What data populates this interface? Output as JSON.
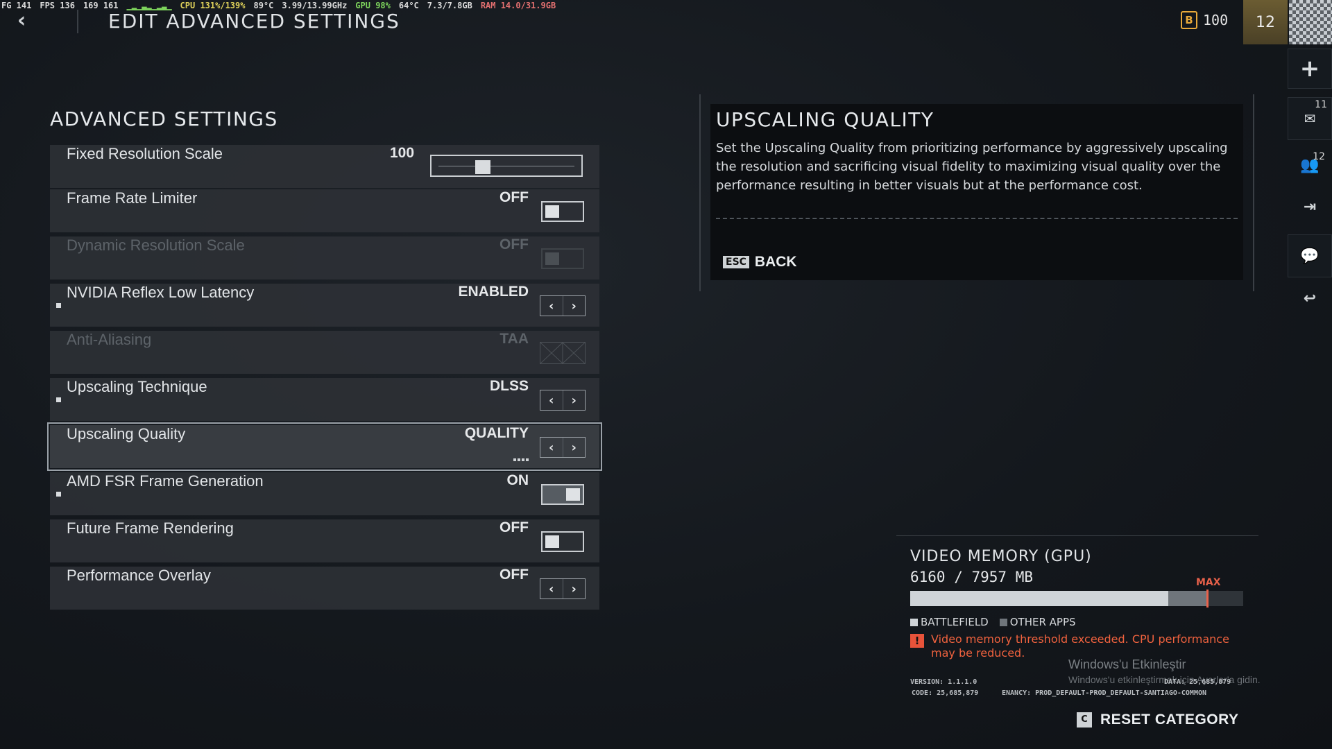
{
  "overlay": {
    "fg": "FG 141",
    "fps": "FPS 136",
    "fps_range": "169 161",
    "cpu": "CPU 131%/139%",
    "cpu_temp": "89°C",
    "cpu_clock": "3.99/13.99GHz",
    "gpu": "GPU 98%",
    "gpu_temp": "64°C",
    "vram": "7.3/7.8GB",
    "ram": "RAM 14.0/31.9GB"
  },
  "header": {
    "back_icon": "chevron-left-icon",
    "title": "EDIT ADVANCED SETTINGS",
    "currency_icon_letter": "B",
    "currency_amount": "100",
    "rank": "12"
  },
  "rail": {
    "plus": "+",
    "mail_badge": "11",
    "friends_badge": "12"
  },
  "settings": {
    "section_title": "ADVANCED SETTINGS",
    "rows": [
      {
        "label": "Fixed Resolution Scale",
        "value": "100",
        "control": "slider",
        "slider_fraction": 0.3
      },
      {
        "label": "Frame Rate Limiter",
        "value": "OFF",
        "control": "toggle",
        "on": false
      },
      {
        "label": "Dynamic Resolution Scale",
        "value": "OFF",
        "control": "toggle",
        "on": false,
        "disabled": true
      },
      {
        "label": "NVIDIA Reflex Low Latency",
        "value": "ENABLED",
        "control": "arrows",
        "bullet": true
      },
      {
        "label": "Anti-Aliasing",
        "value": "TAA",
        "control": "disabled",
        "disabled": true
      },
      {
        "label": "Upscaling Technique",
        "value": "DLSS",
        "control": "arrows",
        "bullet": true
      },
      {
        "label": "Upscaling Quality",
        "value": "QUALITY",
        "control": "arrows",
        "selected": true
      },
      {
        "label": "AMD FSR Frame Generation",
        "value": "ON",
        "control": "toggle",
        "on": true,
        "bullet": true
      },
      {
        "label": "Future Frame Rendering",
        "value": "OFF",
        "control": "toggle",
        "on": false
      },
      {
        "label": "Performance Overlay",
        "value": "OFF",
        "control": "arrows"
      }
    ]
  },
  "info": {
    "title": "UPSCALING QUALITY",
    "description": "Set the Upscaling Quality from prioritizing performance by aggressively upscaling the resolution and sacrificing visual fidelity to maximizing visual quality over the performance resulting in better visuals but at the performance cost.",
    "esc_key": "ESC",
    "back_label": "BACK"
  },
  "memory": {
    "title": "VIDEO MEMORY (GPU)",
    "value": "6160 / 7957 MB",
    "max_label": "MAX",
    "battlefield_fraction": 0.775,
    "other_fraction": 0.12,
    "max_fraction": 0.89,
    "legend_battlefield": "BATTLEFIELD",
    "legend_other": "OTHER APPS",
    "warning": "Video memory threshold exceeded. CPU performance may be reduced.",
    "warning_icon": "!"
  },
  "windows": {
    "title": "Windows'u Etkinleştir",
    "sub": "Windows'u etkinleştirmek için Ayarlar'a gidin."
  },
  "meta": {
    "version": "VERSION: 1.1.1.0",
    "data": "DATA: 25,685,879",
    "code": "CODE: 25,685,879",
    "tenancy": "ENANCY: PROD_DEFAULT-PROD_DEFAULT-SANTIAGO-COMMON"
  },
  "reset": {
    "key": "C",
    "label": "RESET CATEGORY"
  },
  "colors": {
    "accent_warning": "#e8614a",
    "currency": "#e8a93a"
  }
}
